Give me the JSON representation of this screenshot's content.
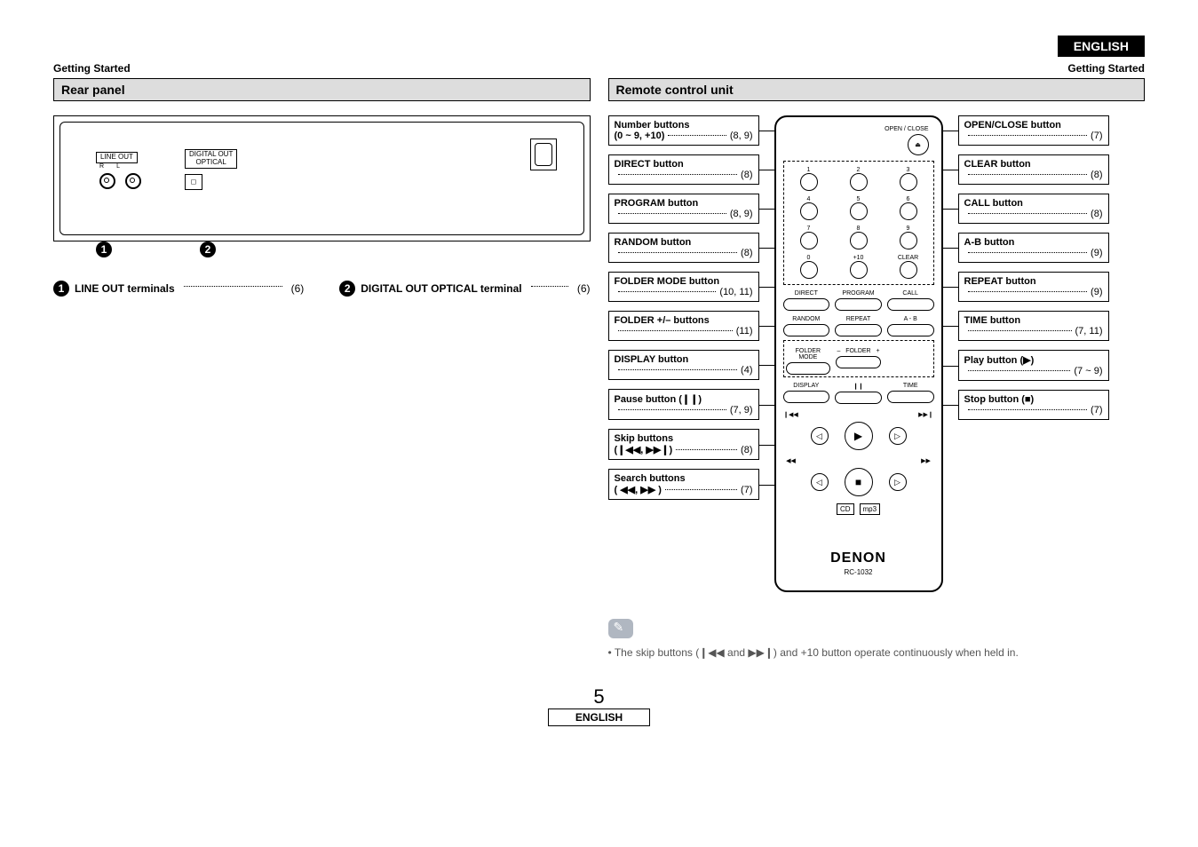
{
  "header": {
    "lang_badge": "ENGLISH",
    "section_left": "Getting Started",
    "section_right": "Getting Started"
  },
  "left": {
    "heading": "Rear panel",
    "lineout_label": "LINE OUT",
    "lineout_r": "R",
    "lineout_l": "L",
    "digital_out_label": "DIGITAL OUT\nOPTICAL",
    "num1": "1",
    "num2": "2",
    "term1_label": "LINE OUT terminals",
    "term1_page": "(6)",
    "term2_label": "DIGITAL OUT OPTICAL terminal",
    "term2_page": "(6)"
  },
  "right": {
    "heading": "Remote control unit",
    "left_callouts": [
      {
        "title": "Number buttons",
        "sub": "(0 ~ 9, +10)",
        "page": "(8, 9)"
      },
      {
        "title": "DIRECT button",
        "sub": "",
        "page": "(8)"
      },
      {
        "title": "PROGRAM button",
        "sub": "",
        "page": "(8, 9)"
      },
      {
        "title": "RANDOM button",
        "sub": "",
        "page": "(8)"
      },
      {
        "title": "FOLDER MODE button",
        "sub": "",
        "page": "(10, 11)"
      },
      {
        "title": "FOLDER +/– buttons",
        "sub": "",
        "page": "(11)"
      },
      {
        "title": "DISPLAY button",
        "sub": "",
        "page": "(4)"
      },
      {
        "title": "Pause button (❙❙)",
        "sub": "",
        "page": "(7, 9)"
      },
      {
        "title": "Skip buttons",
        "sub": "(❙◀◀, ▶▶❙)",
        "page": "(8)"
      },
      {
        "title": "Search buttons",
        "sub": "( ◀◀, ▶▶ )",
        "page": "(7)"
      }
    ],
    "right_callouts": [
      {
        "title": "OPEN/CLOSE button",
        "sub": "",
        "page": "(7)"
      },
      {
        "title": "CLEAR button",
        "sub": "",
        "page": "(8)"
      },
      {
        "title": "CALL button",
        "sub": "",
        "page": "(8)"
      },
      {
        "title": "A-B button",
        "sub": "",
        "page": "(9)"
      },
      {
        "title": "REPEAT button",
        "sub": "",
        "page": "(9)"
      },
      {
        "title": "TIME button",
        "sub": "",
        "page": "(7, 11)"
      },
      {
        "title": "Play button (▶)",
        "sub": "",
        "page": "(7 ~ 9)"
      },
      {
        "title": "Stop button (■)",
        "sub": "",
        "page": "(7)"
      }
    ],
    "remote": {
      "open_close": "OPEN / CLOSE",
      "num_labels": [
        "1",
        "2",
        "3",
        "4",
        "5",
        "6",
        "7",
        "8",
        "9",
        "0",
        "+10",
        "CLEAR"
      ],
      "row_direct": [
        "DIRECT",
        "PROGRAM",
        "CALL"
      ],
      "row_random": [
        "RANDOM",
        "REPEAT",
        "A - B"
      ],
      "row_folder": [
        "FOLDER\nMODE",
        "–   FOLDER   +",
        ""
      ],
      "row_display": [
        "DISPLAY",
        "❙❙",
        "TIME"
      ],
      "brand": "DENON",
      "model": "RC-1032",
      "logo1": "CD",
      "logo2": "mp3"
    }
  },
  "note": "• The skip buttons (❙◀◀ and ▶▶❙) and +10 button operate continuously when held in.",
  "footer": {
    "page": "5",
    "lang": "ENGLISH"
  }
}
